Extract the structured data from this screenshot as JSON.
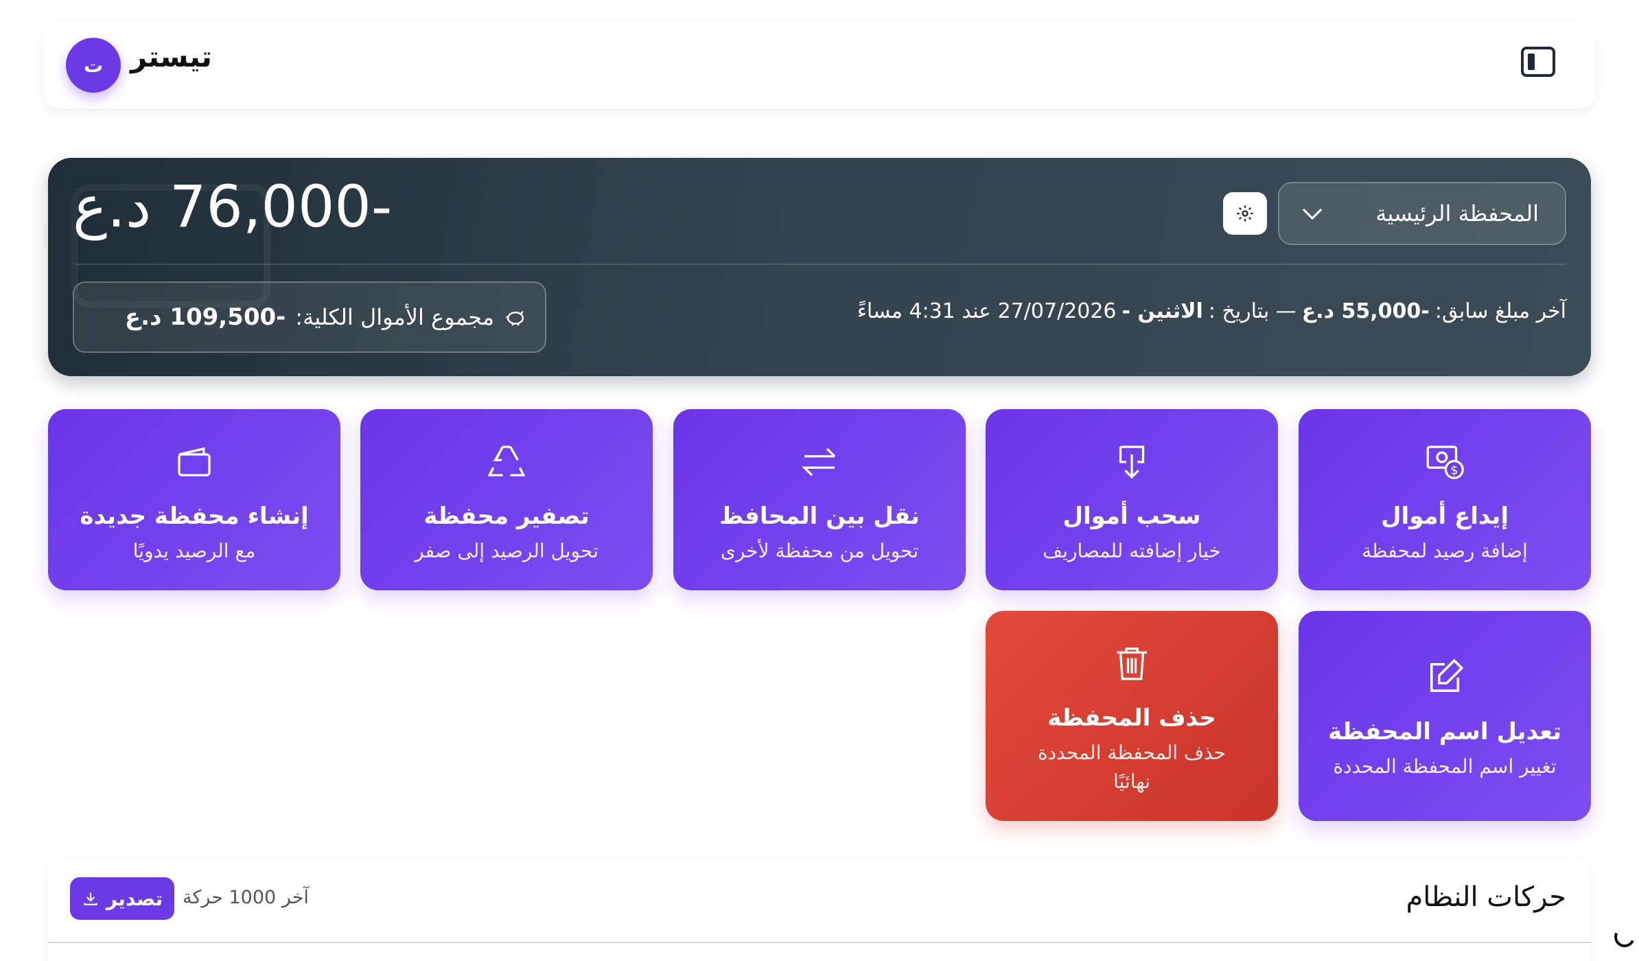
{
  "header": {
    "user_name": "تيستر",
    "avatar_letter": "ت"
  },
  "wallet": {
    "balance": "-76,000 د.ع",
    "selected_wallet": "المحفظة الرئيسية",
    "total_label": "مجموع الأموال الكلية:",
    "total_value": "-109,500 د.ع",
    "last_amount_label": "آخر مبلغ سابق:",
    "last_amount_value": "-55,000 د.ع",
    "last_amount_sep": "— بتاريخ :",
    "last_amount_day": "الاثنين -",
    "last_amount_date": "27/07/2026 عند 4:31 مساءً"
  },
  "actions": [
    {
      "title": "إيداع أموال",
      "subtitle": "إضافة رصيد لمحفظة",
      "icon": "money-deposit-icon"
    },
    {
      "title": "سحب أموال",
      "subtitle": "خيار إضافته للمصاريف",
      "icon": "withdraw-icon"
    },
    {
      "title": "نقل بين المحافظ",
      "subtitle": "تحويل من محفظة لأخرى",
      "icon": "transfer-arrows-icon"
    },
    {
      "title": "تصفير محفظة",
      "subtitle": "تحويل الرصيد إلى صفر",
      "icon": "recycle-icon"
    },
    {
      "title": "إنشاء محفظة جديدة",
      "subtitle": "مع الرصيد يدويًا",
      "icon": "wallet-icon"
    },
    {
      "title": "تعديل اسم المحفظة",
      "subtitle": "تغيير اسم المحفظة المحددة",
      "icon": "edit-icon"
    },
    {
      "title": "حذف المحفظة",
      "subtitle": "حذف المحفظة المحددة نهائيًا",
      "icon": "trash-icon"
    }
  ],
  "moves": {
    "title": "حركات النظام",
    "count": "آخر 1000 حركة",
    "export_label": "تصدير"
  },
  "colors": {
    "accent": "#6c3ae4",
    "danger": "#d93f30",
    "card_dark": "#33434d"
  }
}
